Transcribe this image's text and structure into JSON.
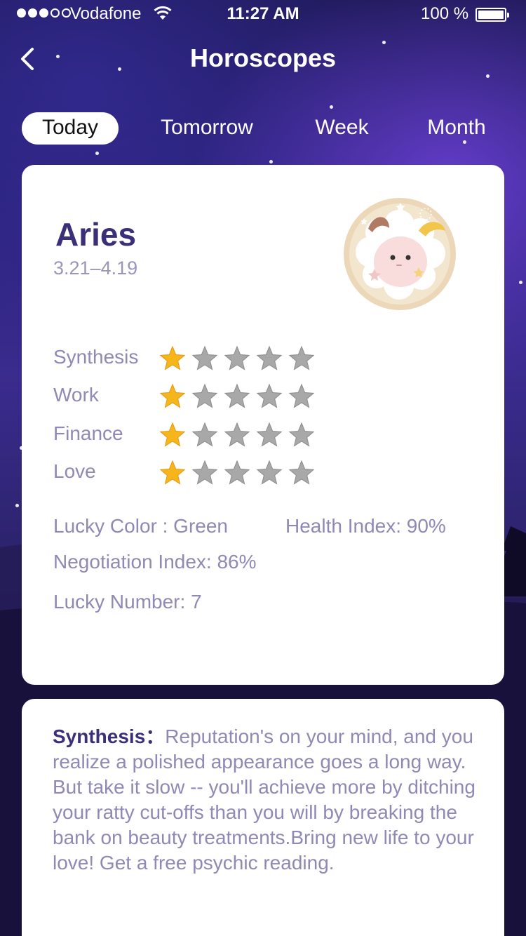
{
  "status_bar": {
    "carrier": "Vodafone",
    "time": "11:27 AM",
    "battery": "100 %"
  },
  "nav": {
    "title": "Horoscopes"
  },
  "tabs": [
    {
      "label": "Today",
      "active": true
    },
    {
      "label": "Tomorrow",
      "active": false
    },
    {
      "label": "Week",
      "active": false
    },
    {
      "label": "Month",
      "active": false
    }
  ],
  "sign": {
    "name": "Aries",
    "dates": "3.21–4.19",
    "avatar_icon": "aries-ram-icon"
  },
  "ratings": [
    {
      "label": "Synthesis",
      "stars": 1,
      "max": 5
    },
    {
      "label": "Work",
      "stars": 1,
      "max": 5
    },
    {
      "label": "Finance",
      "stars": 1,
      "max": 5
    },
    {
      "label": "Love",
      "stars": 1,
      "max": 5
    }
  ],
  "info": {
    "lucky_color": "Lucky Color : Green",
    "health_index": "Health Index: 90%",
    "negotiation_index": "Negotiation Index: 86%",
    "lucky_number": "Lucky Number: 7"
  },
  "description": {
    "label": "Synthesis",
    "separator": "：",
    "text": "Reputation's on your mind, and you realize a polished appearance goes a long way. But take it slow -- you'll achieve more by ditching your ratty cut-offs than you will by breaking the bank on beauty treatments.Bring new life to your love! Get a free psychic reading."
  },
  "colors": {
    "star_filled": "#f7b51c",
    "star_empty": "#a8a8a8",
    "title_purple": "#3a2f78",
    "text_muted": "#8f89b4"
  }
}
